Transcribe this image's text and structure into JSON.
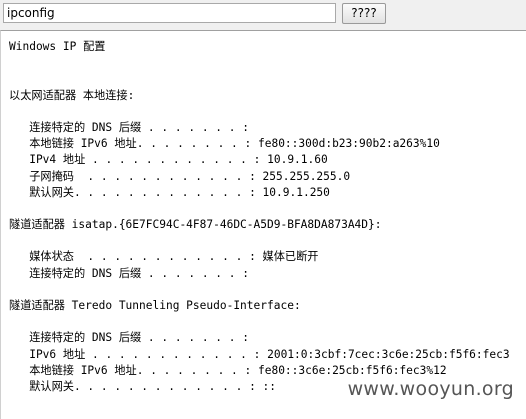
{
  "command": {
    "value": "ipconfig",
    "button_label": "????"
  },
  "output": {
    "lines": [
      "Windows IP 配置",
      "",
      "",
      "以太网适配器 本地连接:",
      "",
      "   连接特定的 DNS 后缀 . . . . . . . :",
      "   本地链接 IPv6 地址. . . . . . . . : fe80::300d:b23:90b2:a263%10",
      "   IPv4 地址 . . . . . . . . . . . . : 10.9.1.60",
      "   子网掩码  . . . . . . . . . . . . : 255.255.255.0",
      "   默认网关. . . . . . . . . . . . . : 10.9.1.250",
      "",
      "隧道适配器 isatap.{6E7FC94C-4F87-46DC-A5D9-BFA8DA873A4D}:",
      "",
      "   媒体状态  . . . . . . . . . . . . : 媒体已断开",
      "   连接特定的 DNS 后缀 . . . . . . . :",
      "",
      "隧道适配器 Teredo Tunneling Pseudo-Interface:",
      "",
      "   连接特定的 DNS 后缀 . . . . . . . :",
      "   IPv6 地址 . . . . . . . . . . . . : 2001:0:3cbf:7cec:3c6e:25cb:f5f6:fec3",
      "   本地链接 IPv6 地址. . . . . . . . : fe80::3c6e:25cb:f5f6:fec3%12",
      "   默认网关. . . . . . . . . . . . . : ::"
    ]
  },
  "watermark": "www.wooyun.org"
}
